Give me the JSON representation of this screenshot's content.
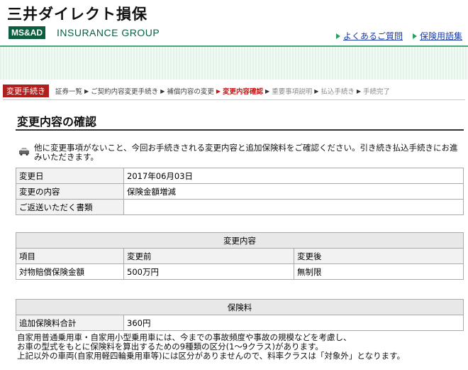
{
  "header": {
    "brand": "三井ダイレクト損保",
    "logo_box": "MS&AD",
    "logo_text": "INSURANCE GROUP",
    "links": [
      {
        "label": "よくあるご質問"
      },
      {
        "label": "保険用語集"
      }
    ]
  },
  "steps": {
    "current_tag": "変更手続き",
    "items": [
      {
        "label": "証券一覧",
        "state": "normal"
      },
      {
        "label": "ご契約内容変更手続き",
        "state": "normal"
      },
      {
        "label": "補償内容の変更",
        "state": "normal"
      },
      {
        "label": "変更内容確認",
        "state": "active"
      },
      {
        "label": "重要事項説明",
        "state": "done"
      },
      {
        "label": "払込手続き",
        "state": "done"
      },
      {
        "label": "手続完了",
        "state": "done"
      }
    ]
  },
  "page": {
    "title": "変更内容の確認",
    "intro": "他に変更事項がないこと、今回お手続きされる変更内容と追加保険料をご確認ください。引き続き払込手続きにお進みいただきます。"
  },
  "summary": {
    "rows": [
      {
        "label": "変更日",
        "value": "2017年06月03日"
      },
      {
        "label": "変更の内容",
        "value": "保険金額増減"
      },
      {
        "label": "ご返送いただく書類",
        "value": ""
      }
    ]
  },
  "changes": {
    "caption": "変更内容",
    "headers": [
      "項目",
      "変更前",
      "変更後"
    ],
    "rows": [
      {
        "item": "対物賠償保険金額",
        "before": "500万円",
        "after": "無制限"
      }
    ]
  },
  "premium": {
    "caption": "保険料",
    "label": "追加保険料合計",
    "value": "360円"
  },
  "note": {
    "line1": "自家用普通乗用車・自家用小型乗用車には、今までの事故頻度や事故の規模などを考慮し、",
    "line2": "お車の型式をもとに保険料を算出するための9種類の区分(1〜9クラス)があります。",
    "line3": "上記以外の車両(自家用軽四輪乗用車等)には区分がありませんので、料率クラスは「対象外」となります。"
  },
  "colors": {
    "brand_green": "#0b5f3e",
    "link_blue": "#1a3caa",
    "step_red": "#b11e1e"
  }
}
